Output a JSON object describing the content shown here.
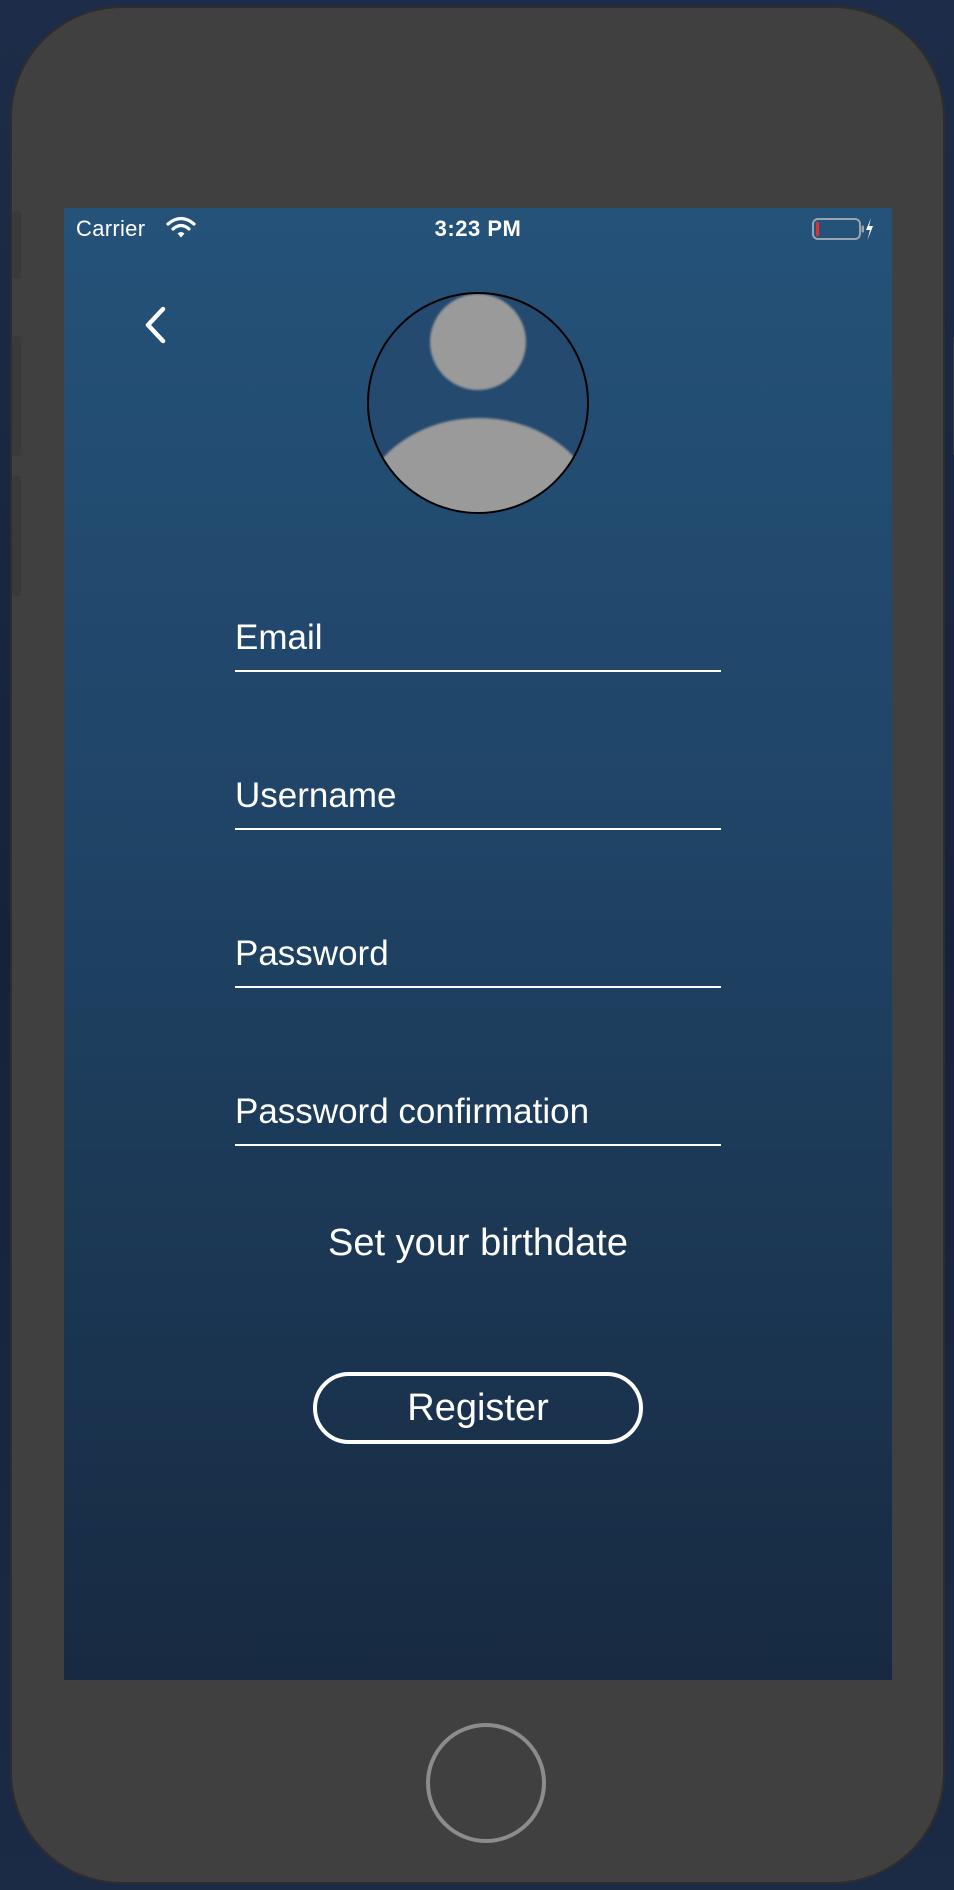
{
  "status_bar": {
    "carrier": "Carrier",
    "time": "3:23 PM",
    "wifi_icon": "wifi-icon",
    "battery_icon": "battery-low-charging-icon"
  },
  "navigation": {
    "back_icon": "chevron-left-icon"
  },
  "avatar": {
    "icon": "user-placeholder-icon"
  },
  "form": {
    "email": {
      "placeholder": "Email",
      "value": ""
    },
    "username": {
      "placeholder": "Username",
      "value": ""
    },
    "password": {
      "placeholder": "Password",
      "value": ""
    },
    "password_confirmation": {
      "placeholder": "Password confirmation",
      "value": ""
    }
  },
  "birthdate_label": "Set your birthdate",
  "register_label": "Register",
  "colors": {
    "screen_gradient_top": "#255279",
    "screen_gradient_bottom": "#172a41",
    "text": "#ffffff",
    "device_frame": "#404040"
  }
}
